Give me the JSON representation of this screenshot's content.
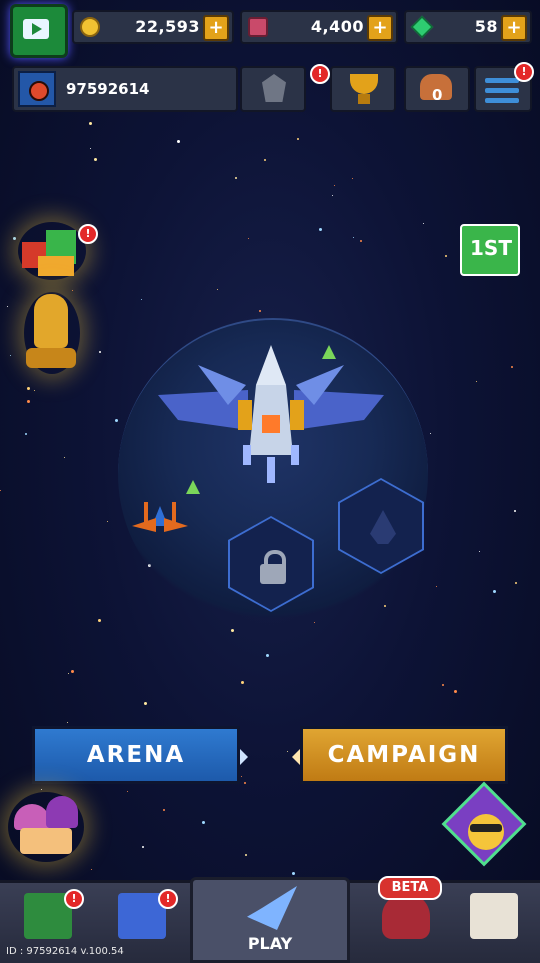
{
  "resources": {
    "coins": "22,593",
    "tickets": "4,400",
    "gems": "58",
    "plus": "+"
  },
  "player": {
    "id": "97592614"
  },
  "top_buttons": {
    "friends_count": "0",
    "alert": "!"
  },
  "side_icons": {
    "bag_label": "1ST"
  },
  "modes": {
    "arena": "ARENA",
    "campaign": "CAMPAIGN"
  },
  "bottom_nav": {
    "play": "PLAY",
    "beta": "BETA",
    "alert": "!"
  },
  "footer": {
    "version": "ID : 97592614  v.100.54"
  },
  "colors": {
    "background": "#0b1030",
    "arena_blue": "#2f7ad0",
    "campaign_gold": "#e0a532",
    "alert_red": "#e32828"
  }
}
